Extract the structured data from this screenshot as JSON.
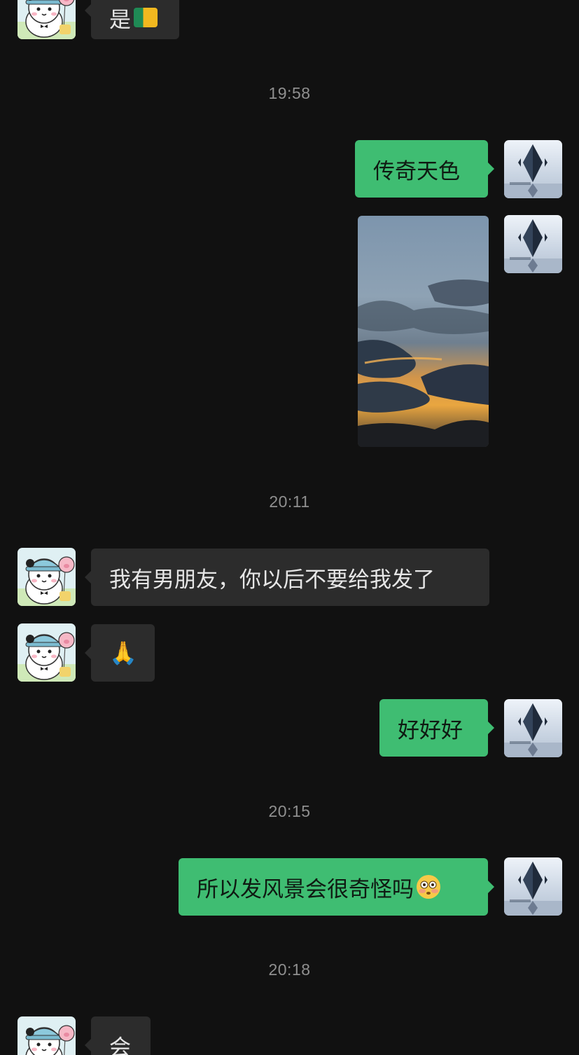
{
  "messages": [
    {
      "side": "in",
      "text": "是"
    },
    {
      "time": "19:58"
    },
    {
      "side": "out",
      "text": "传奇天色"
    },
    {
      "side": "out",
      "image": "sunset-clouds-photo"
    },
    {
      "time": "20:11"
    },
    {
      "side": "in",
      "text": "我有男朋友，你以后不要给我发了"
    },
    {
      "side": "in",
      "emoji": "🙏"
    },
    {
      "side": "out",
      "text": "好好好"
    },
    {
      "time": "20:15"
    },
    {
      "side": "out",
      "text": "所以发风景会很奇怪吗",
      "trailing_emoji": "flushed-face"
    },
    {
      "time": "20:18"
    },
    {
      "side": "in",
      "text": "会"
    }
  ],
  "times": {
    "t1": "19:58",
    "t2": "20:11",
    "t3": "20:15",
    "t4": "20:18"
  },
  "texts": {
    "m0": "是",
    "m1": "传奇天色",
    "m2": "我有男朋友，你以后不要给我发了",
    "m3_emoji": "🙏",
    "m4": "好好好",
    "m5": "所以发风景会很奇怪吗",
    "m6": "会"
  },
  "icons": {
    "contact_avatar": "panda-bear-avatar",
    "self_avatar": "dark-crystal-avatar",
    "flushed": "flushed-face-emoji"
  },
  "colors": {
    "background": "#111111",
    "incoming_bubble": "#2c2c2c",
    "outgoing_bubble": "#3fbd72",
    "timestamp": "#8f8f8f"
  }
}
